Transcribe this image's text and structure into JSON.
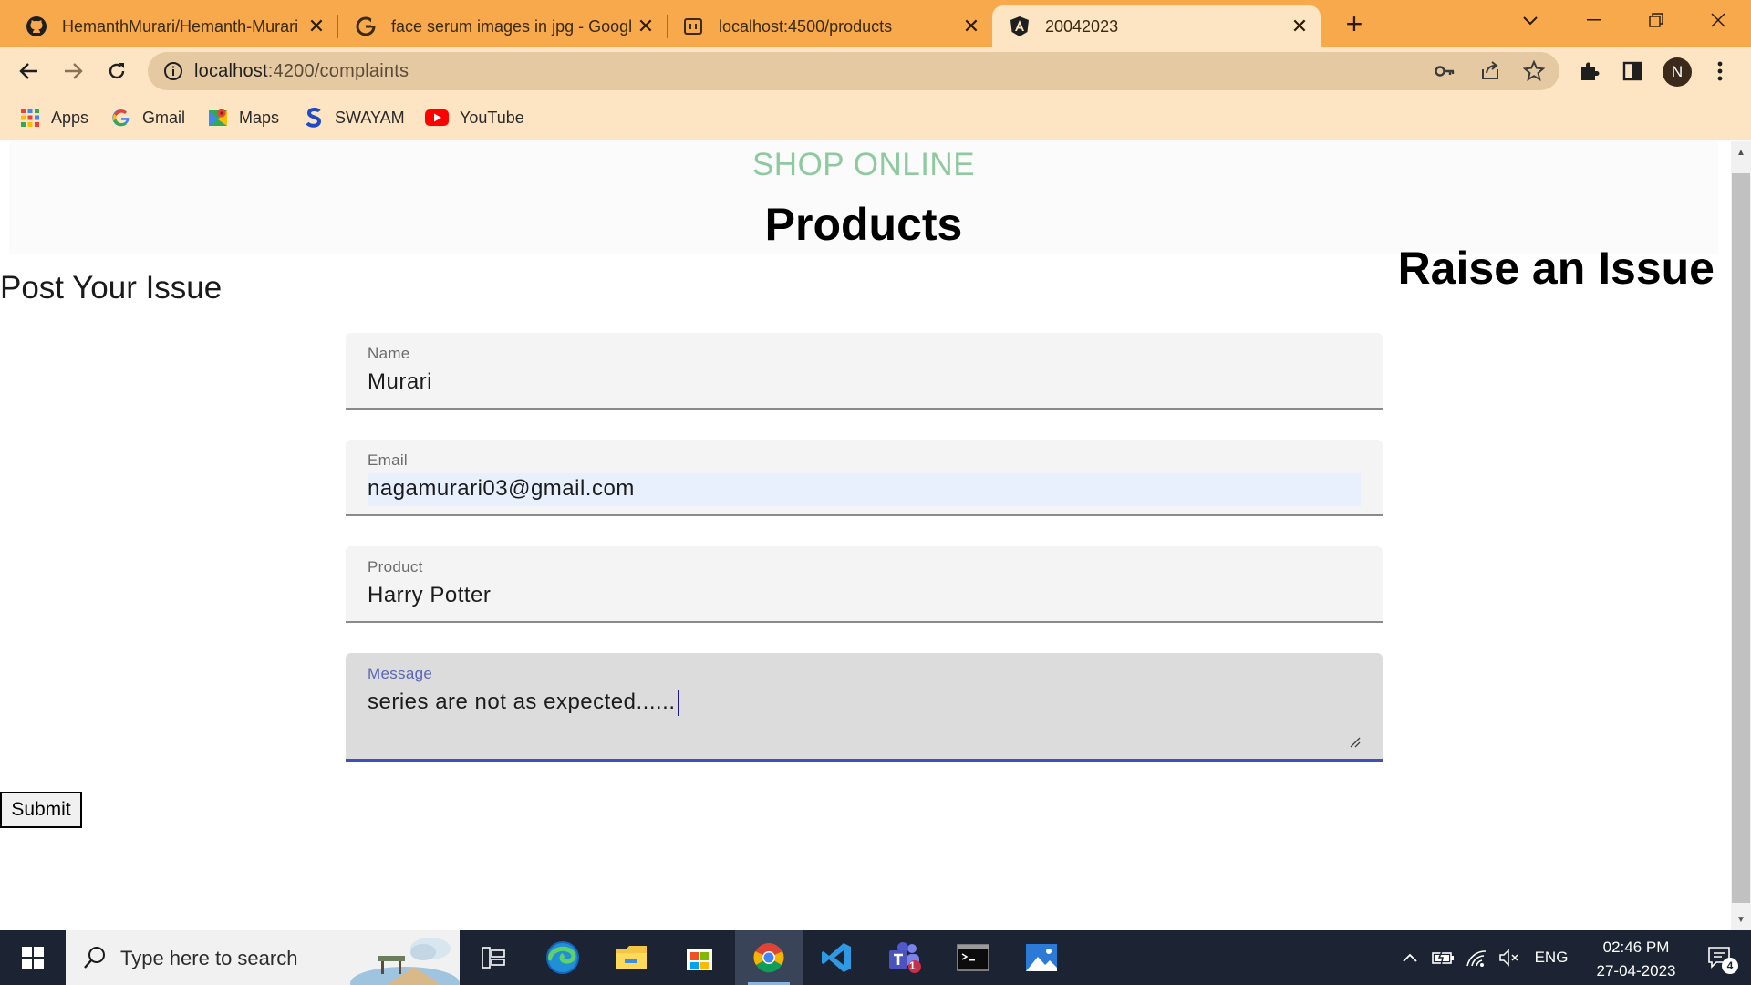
{
  "browser": {
    "tabs": [
      {
        "title": "HemanthMurari/Hemanth-Murari",
        "icon": "github-icon",
        "active": false
      },
      {
        "title": "face serum images in jpg - Google",
        "icon": "google-icon",
        "active": false
      },
      {
        "title": "localhost:4500/products",
        "icon": "loading-icon",
        "active": false
      },
      {
        "title": "20042023",
        "icon": "angular-icon",
        "active": true
      }
    ],
    "url_host": "localhost",
    "url_rest": ":4200/complaints",
    "profile_initial": "N",
    "bookmarks": [
      {
        "label": "Apps",
        "icon": "apps-grid-icon"
      },
      {
        "label": "Gmail",
        "icon": "google-icon"
      },
      {
        "label": "Maps",
        "icon": "maps-icon"
      },
      {
        "label": "SWAYAM",
        "icon": "swayam-icon"
      },
      {
        "label": "YouTube",
        "icon": "youtube-icon"
      }
    ]
  },
  "page": {
    "brand": "SHOP ONLINE",
    "title": "Products",
    "raise_heading": "Raise an Issue",
    "post_heading": "Post Your Issue",
    "form": {
      "name": {
        "label": "Name",
        "value": "Murari"
      },
      "email": {
        "label": "Email",
        "value": "nagamurari03@gmail.com"
      },
      "product": {
        "label": "Product",
        "value": "Harry Potter"
      },
      "message": {
        "label": "Message",
        "value": "series are not as expected......"
      }
    },
    "submit_label": "Submit"
  },
  "taskbar": {
    "search_placeholder": "Type here to search",
    "language": "ENG",
    "time": "02:46 PM",
    "date": "27-04-2023",
    "teams_badge": "1",
    "notification_count": "4"
  },
  "colors": {
    "tabstrip": "#f7a94c",
    "toolbar": "#fde4c2",
    "brand_green": "#8fc9a0",
    "focus_blue": "#3f51b5",
    "taskbar": "#1c2433"
  }
}
